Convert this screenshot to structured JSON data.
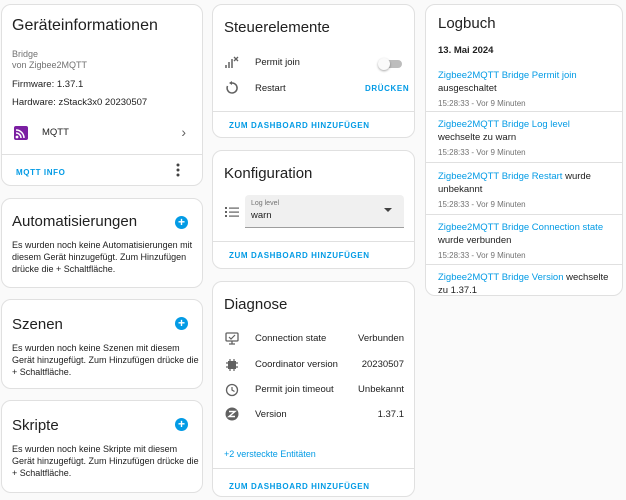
{
  "device_info": {
    "title": "Geräteinformationen",
    "type": "Bridge",
    "by": "von Zigbee2MQTT",
    "firmware": "Firmware: 1.37.1",
    "hardware": "Hardware: zStack3x0 20230507",
    "integration_label": "MQTT",
    "mqtt_info_label": "MQTT INFO"
  },
  "automations": {
    "title": "Automatisierungen",
    "desc": "Es wurden noch keine Automatisierungen mit diesem Gerät hinzugefügt. Zum Hinzufügen drücke die + Schaltfläche."
  },
  "scenes": {
    "title": "Szenen",
    "desc": "Es wurden noch keine Szenen mit diesem Gerät hinzugefügt. Zum Hinzufügen drücke die + Schaltfläche."
  },
  "scripts": {
    "title": "Skripte",
    "desc": "Es wurden noch keine Skripte mit diesem Gerät hinzugefügt. Zum Hinzufügen drücke die + Schaltfläche."
  },
  "controls": {
    "title": "Steuerelemente",
    "permit_join_label": "Permit join",
    "permit_join_on": false,
    "restart_label": "Restart",
    "restart_action": "DRÜCKEN",
    "add_to_dashboard": "ZUM DASHBOARD HINZUFÜGEN"
  },
  "configuration": {
    "title": "Konfiguration",
    "log_level_caption": "Log level",
    "log_level_value": "warn",
    "add_to_dashboard": "ZUM DASHBOARD HINZUFÜGEN"
  },
  "diagnostics": {
    "title": "Diagnose",
    "rows": [
      {
        "label": "Connection state",
        "value": "Verbunden"
      },
      {
        "label": "Coordinator version",
        "value": "20230507"
      },
      {
        "label": "Permit join timeout",
        "value": "Unbekannt"
      },
      {
        "label": "Version",
        "value": "1.37.1"
      }
    ],
    "hidden_entities": "+2 versteckte Entitäten",
    "add_to_dashboard": "ZUM DASHBOARD HINZUFÜGEN"
  },
  "logbook": {
    "title": "Logbuch",
    "date": "13. Mai 2024",
    "entries": [
      {
        "entity": "Zigbee2MQTT Bridge Permit join",
        "text": "ausgeschaltet",
        "time": "15:28:33 - Vor 9 Minuten"
      },
      {
        "entity": "Zigbee2MQTT Bridge Log level",
        "text": "wechselte zu warn",
        "time": "15:28:33 - Vor 9 Minuten"
      },
      {
        "entity": "Zigbee2MQTT Bridge Restart",
        "text": "wurde unbekannt",
        "time": "15:28:33 - Vor 9 Minuten"
      },
      {
        "entity": "Zigbee2MQTT Bridge Connection state",
        "text": "wurde verbunden",
        "time": "15:28:33 - Vor 9 Minuten"
      },
      {
        "entity": "Zigbee2MQTT Bridge Version",
        "text": "wechselte zu 1.37.1",
        "time": ""
      }
    ]
  },
  "colors": {
    "accent": "#039be5",
    "mqtt_icon": "#7b1fa2"
  }
}
